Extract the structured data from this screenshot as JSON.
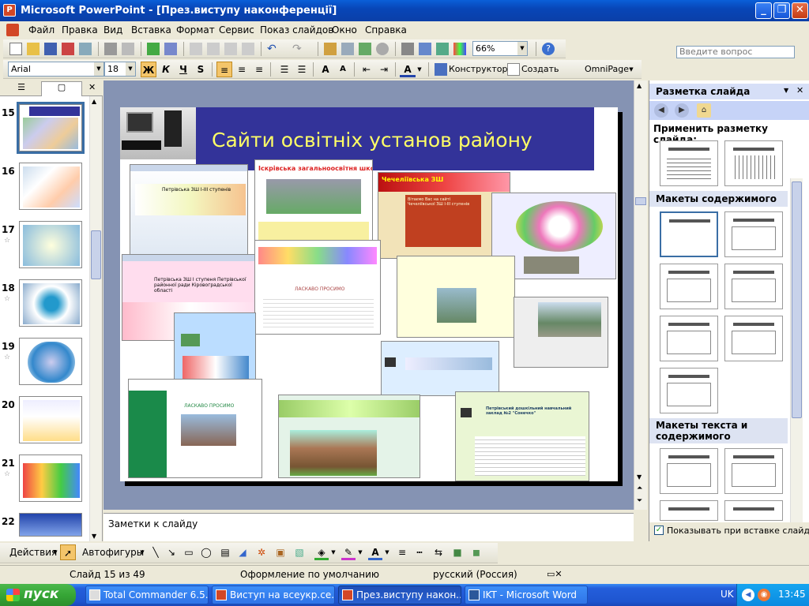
{
  "window": {
    "title": "Microsoft PowerPoint - [През.виступу наконференції]",
    "icon": "powerpoint-icon"
  },
  "menu": [
    "Файл",
    "Правка",
    "Вид",
    "Вставка",
    "Формат",
    "Сервис",
    "Показ слайдов",
    "Окно",
    "Справка"
  ],
  "help_placeholder": "Введите вопрос",
  "toolbar": {
    "zoom": "66%"
  },
  "format_toolbar": {
    "font": "Arial",
    "size": "18",
    "bold": "Ж",
    "italic": "К",
    "underline": "Ч",
    "shadow": "S",
    "designer": "Конструктор",
    "new_slide": "Создать слайд",
    "omnipage": "OmniPage"
  },
  "slides": {
    "items": [
      {
        "num": "15",
        "star": ""
      },
      {
        "num": "16",
        "star": ""
      },
      {
        "num": "17",
        "star": "☆"
      },
      {
        "num": "18",
        "star": "☆"
      },
      {
        "num": "19",
        "star": "☆"
      },
      {
        "num": "20",
        "star": ""
      },
      {
        "num": "21",
        "star": "☆"
      },
      {
        "num": "22",
        "star": ""
      }
    ]
  },
  "slide": {
    "title": "Сайти освітніх установ району",
    "shots": [
      {
        "heading": "Петрівська ЗШ І-ІІІ ступенів"
      },
      {
        "heading": "Іскрівська загальноосвітня школа"
      },
      {
        "heading": "Чечеліївська ЗШ"
      },
      {
        "heading": "Вітаємо Вас на сайті Чечеліївської ЗШ І-ІІІ ступенів"
      },
      {
        "heading": "Петрівська ЗШ І ступеня Петрівської районної ради Кіровоградської області"
      },
      {
        "heading": "ЛАСКАВО ПРОСИМО"
      },
      {
        "heading": "ЛАСКАВО ПРОСИМО"
      },
      {
        "heading": "Петрівський дошкільний навчальний заклад №2 \"Сонечко\""
      }
    ]
  },
  "notes_placeholder": "Заметки к слайду",
  "taskpane": {
    "title": "Разметка слайда",
    "apply_label": "Применить разметку слайда:",
    "section_content": "Макеты содержимого",
    "section_text_content": "Макеты текста и содержимого",
    "show_on_insert": "Показывать при вставке слайдов"
  },
  "draw_toolbar": {
    "actions": "Действия",
    "autoshapes": "Автофигуры"
  },
  "status": {
    "slide": "Слайд 15 из 49",
    "design": "Оформление по умолчанию",
    "language": "русский (Россия)"
  },
  "taskbar": {
    "start": "пуск",
    "tasks": [
      "Total Commander 6.5...",
      "Виступ на всеукр.се...",
      "През.виступу након...",
      "IKT - Microsoft Word"
    ],
    "lang": "UK",
    "time": "13:45"
  }
}
